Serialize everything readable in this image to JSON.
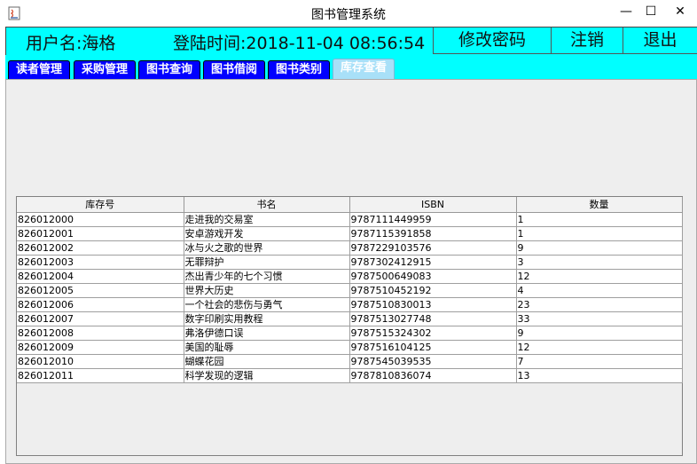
{
  "window": {
    "title": "图书管理系统",
    "min_glyph": "—",
    "max_glyph": "☐",
    "close_glyph": "✕"
  },
  "header": {
    "user_label": "用户名:海格",
    "login_time": "登陆时间:2018-11-04 08:56:54",
    "change_password": "修改密码",
    "logout": "注销",
    "exit": "退出"
  },
  "tabs": [
    {
      "label": "读者管理",
      "active": false
    },
    {
      "label": "采购管理",
      "active": false
    },
    {
      "label": "图书查询",
      "active": false
    },
    {
      "label": "图书借阅",
      "active": false
    },
    {
      "label": "图书类别",
      "active": false
    },
    {
      "label": "库存查看",
      "active": true
    }
  ],
  "table": {
    "columns": [
      "库存号",
      "书名",
      "ISBN",
      "数量"
    ],
    "rows": [
      [
        "826012000",
        "走进我的交易室",
        "9787111449959",
        "1"
      ],
      [
        "826012001",
        "安卓游戏开发",
        "9787115391858",
        "1"
      ],
      [
        "826012002",
        "冰与火之歌的世界",
        "9787229103576",
        "9"
      ],
      [
        "826012003",
        "无罪辩护",
        "9787302412915",
        "3"
      ],
      [
        "826012004",
        "杰出青少年的七个习惯",
        "9787500649083",
        "12"
      ],
      [
        "826012005",
        "世界大历史",
        "9787510452192",
        "4"
      ],
      [
        "826012006",
        "一个社会的悲伤与勇气",
        "9787510830013",
        "23"
      ],
      [
        "826012007",
        "数字印刷实用教程",
        "9787513027748",
        "33"
      ],
      [
        "826012008",
        "弗洛伊德口误",
        "9787515324302",
        "9"
      ],
      [
        "826012009",
        "美国的耻辱",
        "9787516104125",
        "12"
      ],
      [
        "826012010",
        "蝴蝶花园",
        "9787545039535",
        "7"
      ],
      [
        "826012011",
        "科学发现的逻辑",
        "9787810836074",
        "13"
      ]
    ]
  }
}
